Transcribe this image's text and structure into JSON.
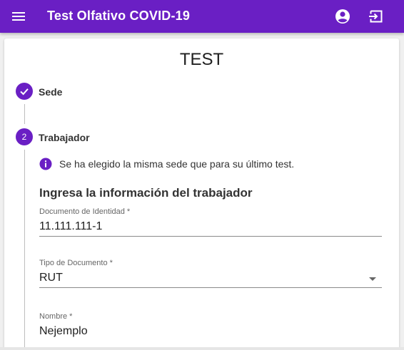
{
  "app": {
    "title": "Test Olfativo COVID-19",
    "colors": {
      "primary": "#6a1fc4",
      "on_primary": "#ffffff"
    },
    "icons": {
      "menu": "menu-icon",
      "account": "account-circle-icon",
      "exit": "exit-icon"
    }
  },
  "card": {
    "title": "TEST"
  },
  "steps": [
    {
      "label": "Sede",
      "state": "completed",
      "icon": "check-icon"
    },
    {
      "label": "Trabajador",
      "state": "active",
      "number": "2"
    }
  ],
  "info": {
    "icon": "info-icon",
    "text": "Se ha elegido la misma sede que para su último test."
  },
  "form": {
    "heading": "Ingresa la información del trabajador",
    "fields": [
      {
        "label": "Documento de Identidad *",
        "value": "11.111.111-1"
      },
      {
        "label": "Tipo de Documento *",
        "value": "RUT"
      },
      {
        "label": "Nombre *",
        "value": "Nejemplo"
      }
    ]
  }
}
